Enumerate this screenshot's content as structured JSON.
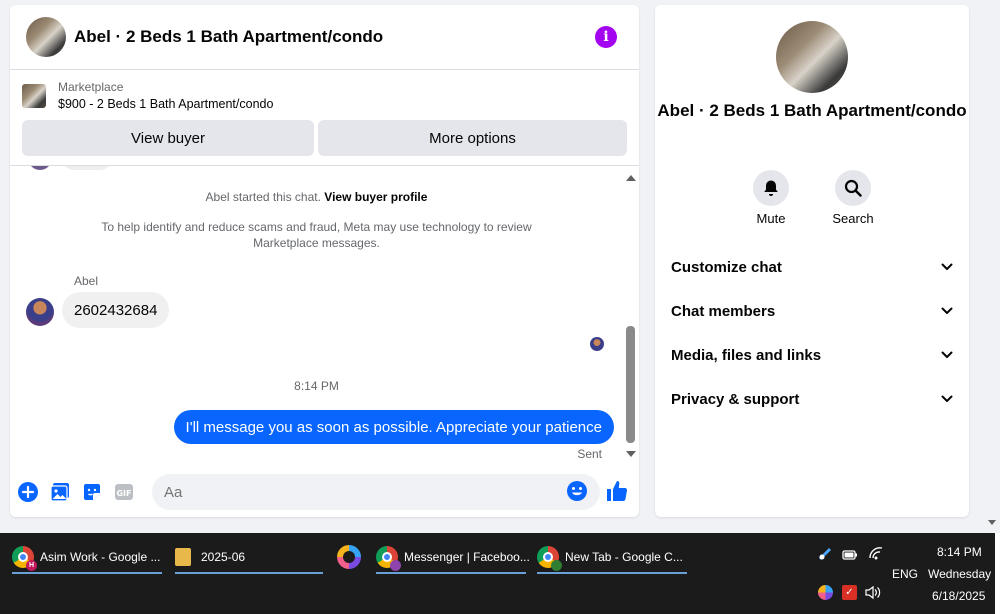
{
  "chat": {
    "title": "Abel · 2 Beds 1 Bath Apartment/condo",
    "marketplace_label": "Marketplace",
    "listing": "$900 - 2 Beds 1 Bath Apartment/condo",
    "view_buyer_label": "View buyer",
    "more_options_label": "More options",
    "system_started": "Abel started this chat.",
    "system_profile_link": "View buyer profile",
    "system_notice": "To help identify and reduce scams and fraud, Meta may use technology to review Marketplace messages.",
    "sender_name": "Abel",
    "incoming_message": "2602432684",
    "timestamp": "8:14 PM",
    "outgoing_message": "I'll message you as soon as possible. Appreciate your patience",
    "sent_status": "Sent",
    "input_placeholder": "Aa",
    "accent_color": "#0866ff",
    "info_color": "#a405f0"
  },
  "side": {
    "title": "Abel · 2 Beds 1 Bath Apartment/condo",
    "mute_label": "Mute",
    "search_label": "Search",
    "sections": [
      {
        "label": "Customize chat"
      },
      {
        "label": "Chat members"
      },
      {
        "label": "Media, files and links"
      },
      {
        "label": "Privacy & support"
      }
    ]
  },
  "taskbar": {
    "tasks": [
      {
        "label": "Asim Work - Google ...",
        "badge": "H"
      },
      {
        "label": "2025-06"
      },
      {
        "label": "Messenger | Faceboo..."
      },
      {
        "label": "New Tab - Google C..."
      }
    ],
    "language": "ENG",
    "time": "8:14 PM",
    "day": "Wednesday",
    "date": "6/18/2025"
  }
}
